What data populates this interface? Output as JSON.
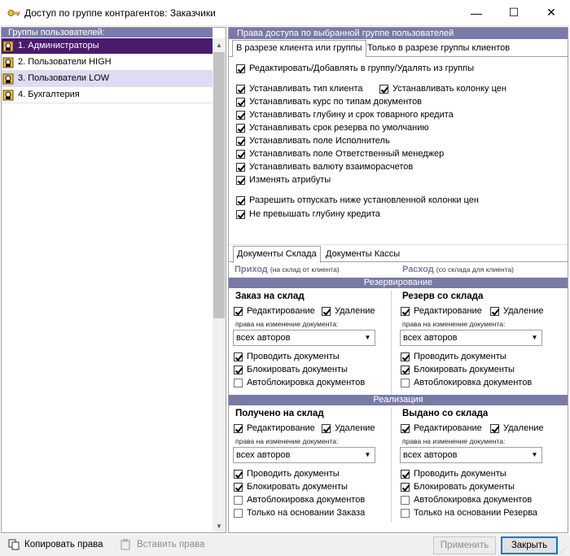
{
  "window": {
    "title": "Доступ по группе контрагентов: Заказчики",
    "minimize": "—",
    "maximize": "☐",
    "close": "✕"
  },
  "groups": {
    "header": "Группы пользователей:",
    "items": [
      {
        "label": "1. Администраторы"
      },
      {
        "label": "2. Пользователи HIGH"
      },
      {
        "label": "3. Пользователи LOW"
      },
      {
        "label": "4. Бухгалтерия"
      }
    ]
  },
  "rights": {
    "header": "Права доступа по выбранной группе пользователей",
    "tabs": [
      "В разрезе клиента или группы",
      "Только в разрезе группы клиентов"
    ],
    "checks": {
      "edit_group": "Редактировать/Добавлять в группу/Удалять из группы",
      "client_type": "Устанавливать тип клиента",
      "price_col": "Устанавливать колонку цен",
      "rate": "Устанавливать курс по типам документов",
      "credit": "Устанавливать глубину и срок товарного кредита",
      "reserve": "Устанавливать срок резерва по умолчанию",
      "executor": "Устанавливать поле Исполнитель",
      "manager": "Устанавливать поле Ответственный менеджер",
      "currency": "Устанавливать валюту взаиморасчетов",
      "attrs": "Изменять атрибуты",
      "below_price": "Разрешить отпускать ниже установленной колонки цен",
      "no_exceed": "Не превышать глубину кредита"
    }
  },
  "docs": {
    "tabs": [
      "Документы Склада",
      "Документы Кассы"
    ],
    "income": {
      "label": "Приход",
      "sub": "(на склад от клиента)"
    },
    "outcome": {
      "label": "Расход",
      "sub": "(со склада для клиента)"
    },
    "section_reserve": "Резервирование",
    "section_sales": "Реализация",
    "order_title": "Заказ на склад",
    "reserve_title": "Резерв со склада",
    "received_title": "Получено на склад",
    "issued_title": "Выдано со склада",
    "edit": "Редактирование",
    "delete": "Удаление",
    "rights_caption": "права на изменение документа:",
    "authors": "всех авторов",
    "post": "Проводить документы",
    "block": "Блокировать документы",
    "autoblock": "Автоблокировка документов",
    "only_order": "Только на основании Заказа",
    "only_reserve": "Только на основании Резерва"
  },
  "bottom": {
    "copy": "Копировать права",
    "paste": "Вставить права",
    "apply": "Применить",
    "close": "Закрыть"
  }
}
